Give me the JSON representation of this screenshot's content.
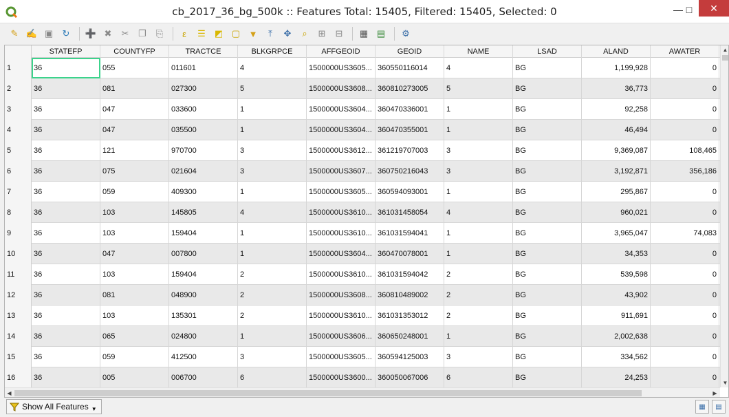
{
  "window": {
    "title": "cb_2017_36_bg_500k :: Features Total: 15405, Filtered: 15405, Selected: 0",
    "min_icon": "minimize-icon",
    "max_icon": "maximize-icon",
    "close_icon": "close-icon"
  },
  "toolbar": {
    "icons": [
      "pencil-icon",
      "multi-edit-icon",
      "save-icon",
      "reload-icon",
      "add-feature-icon",
      "delete-icon",
      "cut-icon",
      "copy-icon",
      "paste-icon",
      "expression-select-icon",
      "select-all-icon",
      "invert-selection-icon",
      "deselect-icon",
      "filter-icon",
      "move-to-top-icon",
      "pan-to-selected-icon",
      "zoom-to-selected-icon",
      "new-field-icon",
      "delete-field-icon",
      "field-calculator-icon",
      "conditional-format-icon",
      "actions-icon"
    ]
  },
  "table": {
    "columns": [
      "STATEFP",
      "COUNTYFP",
      "TRACTCE",
      "BLKGRPCE",
      "AFFGEOID",
      "GEOID",
      "NAME",
      "LSAD",
      "ALAND",
      "AWATER"
    ],
    "rows": [
      {
        "n": "1",
        "c": [
          "36",
          "055",
          "011601",
          "4",
          "1500000US3605...",
          "360550116014",
          "4",
          "BG",
          "1,199,928",
          "0"
        ]
      },
      {
        "n": "2",
        "c": [
          "36",
          "081",
          "027300",
          "5",
          "1500000US3608...",
          "360810273005",
          "5",
          "BG",
          "36,773",
          "0"
        ]
      },
      {
        "n": "3",
        "c": [
          "36",
          "047",
          "033600",
          "1",
          "1500000US3604...",
          "360470336001",
          "1",
          "BG",
          "92,258",
          "0"
        ]
      },
      {
        "n": "4",
        "c": [
          "36",
          "047",
          "035500",
          "1",
          "1500000US3604...",
          "360470355001",
          "1",
          "BG",
          "46,494",
          "0"
        ]
      },
      {
        "n": "5",
        "c": [
          "36",
          "121",
          "970700",
          "3",
          "1500000US3612...",
          "361219707003",
          "3",
          "BG",
          "9,369,087",
          "108,465"
        ]
      },
      {
        "n": "6",
        "c": [
          "36",
          "075",
          "021604",
          "3",
          "1500000US3607...",
          "360750216043",
          "3",
          "BG",
          "3,192,871",
          "356,186"
        ]
      },
      {
        "n": "7",
        "c": [
          "36",
          "059",
          "409300",
          "1",
          "1500000US3605...",
          "360594093001",
          "1",
          "BG",
          "295,867",
          "0"
        ]
      },
      {
        "n": "8",
        "c": [
          "36",
          "103",
          "145805",
          "4",
          "1500000US3610...",
          "361031458054",
          "4",
          "BG",
          "960,021",
          "0"
        ]
      },
      {
        "n": "9",
        "c": [
          "36",
          "103",
          "159404",
          "1",
          "1500000US3610...",
          "361031594041",
          "1",
          "BG",
          "3,965,047",
          "74,083"
        ]
      },
      {
        "n": "10",
        "c": [
          "36",
          "047",
          "007800",
          "1",
          "1500000US3604...",
          "360470078001",
          "1",
          "BG",
          "34,353",
          "0"
        ]
      },
      {
        "n": "11",
        "c": [
          "36",
          "103",
          "159404",
          "2",
          "1500000US3610...",
          "361031594042",
          "2",
          "BG",
          "539,598",
          "0"
        ]
      },
      {
        "n": "12",
        "c": [
          "36",
          "081",
          "048900",
          "2",
          "1500000US3608...",
          "360810489002",
          "2",
          "BG",
          "43,902",
          "0"
        ]
      },
      {
        "n": "13",
        "c": [
          "36",
          "103",
          "135301",
          "2",
          "1500000US3610...",
          "361031353012",
          "2",
          "BG",
          "911,691",
          "0"
        ]
      },
      {
        "n": "14",
        "c": [
          "36",
          "065",
          "024800",
          "1",
          "1500000US3606...",
          "360650248001",
          "1",
          "BG",
          "2,002,638",
          "0"
        ]
      },
      {
        "n": "15",
        "c": [
          "36",
          "059",
          "412500",
          "3",
          "1500000US3605...",
          "360594125003",
          "3",
          "BG",
          "334,562",
          "0"
        ]
      },
      {
        "n": "16",
        "c": [
          "36",
          "005",
          "006700",
          "6",
          "1500000US3600...",
          "360050067006",
          "6",
          "BG",
          "24,253",
          "0"
        ]
      }
    ]
  },
  "bottom": {
    "filter_label": "Show All Features",
    "filter_icon": "filter-icon",
    "form_view_icon": "form-view-icon",
    "table_view_icon": "table-view-icon"
  },
  "colors": {
    "selected_cell": "#3cd38c",
    "close_button": "#c43c3c",
    "alt_row": "#e9e9e9"
  }
}
